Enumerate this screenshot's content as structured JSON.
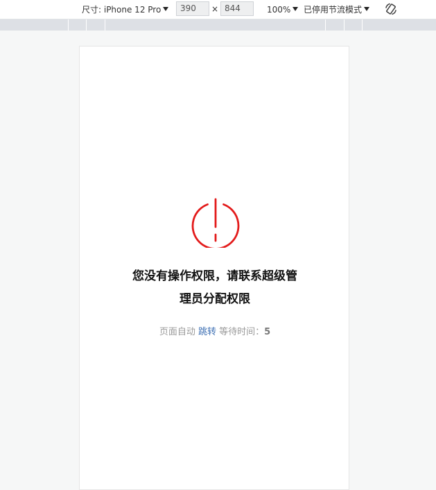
{
  "toolbar": {
    "device_label": "尺寸: iPhone 12 Pro",
    "width_value": "390",
    "times_symbol": "×",
    "height_value": "844",
    "zoom_label": "100%",
    "throttle_label": "已停用节流模式",
    "rotate_icon": "rotate-icon"
  },
  "page": {
    "icon": "power-icon",
    "icon_color": "#e31b1b",
    "message_line1": "您没有操作权限，请联系超级管",
    "message_line2": "理员分配权限",
    "redirect_prefix": "页面自动",
    "redirect_link": "跳转",
    "redirect_wait_label": "等待时间：",
    "redirect_countdown": "5"
  }
}
